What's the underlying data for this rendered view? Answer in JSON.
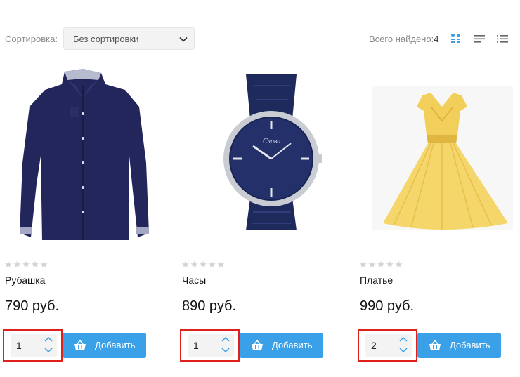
{
  "toolbar": {
    "sort_label": "Сортировка:",
    "sort_value": "Без сортировки",
    "found_label": "Всего найдено:",
    "found_count": "4",
    "accent": "#3aa0e7"
  },
  "products": [
    {
      "name": "Рубашка",
      "price": "790 руб.",
      "qty": "1",
      "stars": "★★★★★",
      "add_label": "Добавить",
      "image": "navy-shirt"
    },
    {
      "name": "Часы",
      "price": "890 руб.",
      "qty": "1",
      "stars": "★★★★★",
      "add_label": "Добавить",
      "image": "wristwatch"
    },
    {
      "name": "Платье",
      "price": "990 руб.",
      "qty": "2",
      "stars": "★★★★★",
      "add_label": "Добавить",
      "image": "yellow-dress"
    }
  ]
}
